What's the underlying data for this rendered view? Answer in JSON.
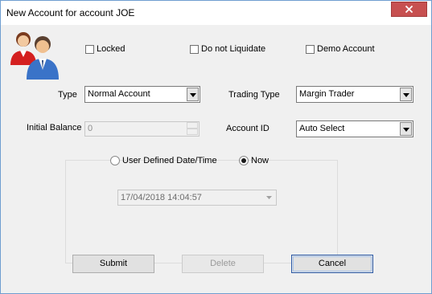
{
  "window": {
    "title": "New Account for account JOE"
  },
  "checkboxes": {
    "locked": "Locked",
    "do_not_liquidate": "Do not Liquidate",
    "demo_account": "Demo Account"
  },
  "fields": {
    "type": {
      "label": "Type",
      "value": "Normal Account"
    },
    "trading_type": {
      "label": "Trading Type",
      "value": "Margin Trader"
    },
    "initial_balance": {
      "label": "Initial Balance",
      "value": "0"
    },
    "account_id": {
      "label": "Account ID",
      "value": "Auto Select"
    }
  },
  "datetime": {
    "user_defined": "User Defined Date/Time",
    "now": "Now",
    "selected": "now",
    "value": "17/04/2018 14:04:57"
  },
  "buttons": {
    "submit": "Submit",
    "delete": "Delete",
    "cancel": "Cancel"
  },
  "icons": {
    "close": "close-icon",
    "users": "users-icon",
    "dropdown": "chevron-down-icon"
  },
  "colors": {
    "close_button": "#c75050",
    "window_border": "#6f9ed0",
    "default_button_border": "#2b5aa8"
  }
}
